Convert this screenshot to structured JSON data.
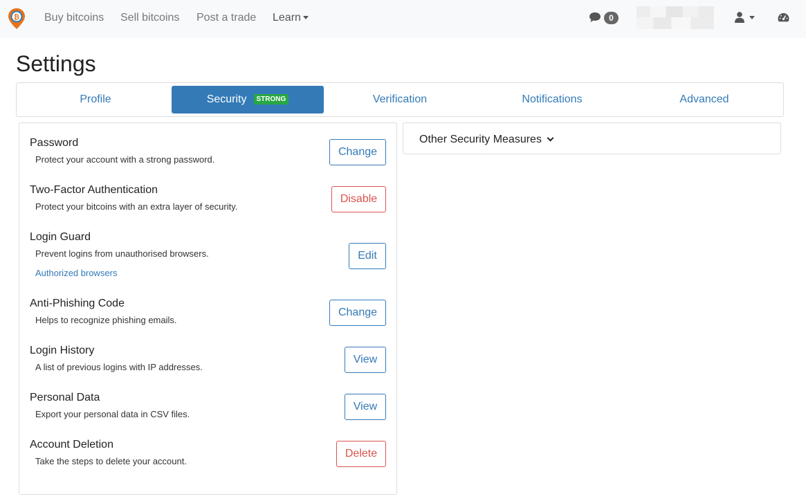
{
  "navbar": {
    "links": {
      "buy": "Buy bitcoins",
      "sell": "Sell bitcoins",
      "post": "Post a trade",
      "learn": "Learn"
    },
    "messages_count": "0"
  },
  "page": {
    "title": "Settings"
  },
  "tabs": {
    "profile": "Profile",
    "security": "Security",
    "security_badge": "STRONG",
    "verification": "Verification",
    "notifications": "Notifications",
    "advanced": "Advanced"
  },
  "security": {
    "password": {
      "title": "Password",
      "desc": "Protect your account with a strong password.",
      "button": "Change"
    },
    "two_factor": {
      "title": "Two-Factor Authentication",
      "desc": "Protect your bitcoins with an extra layer of security.",
      "button": "Disable"
    },
    "login_guard": {
      "title": "Login Guard",
      "desc": "Prevent logins from unauthorised browsers.",
      "link": "Authorized browsers",
      "button": "Edit"
    },
    "anti_phishing": {
      "title": "Anti-Phishing Code",
      "desc": "Helps to recognize phishing emails.",
      "button": "Change"
    },
    "login_history": {
      "title": "Login History",
      "desc": "A list of previous logins with IP addresses.",
      "button": "View"
    },
    "personal_data": {
      "title": "Personal Data",
      "desc": "Export your personal data in CSV files.",
      "button": "View"
    },
    "account_deletion": {
      "title": "Account Deletion",
      "desc": "Take the steps to delete your account.",
      "button": "Delete"
    }
  },
  "other_measures": {
    "label": "Other Security Measures"
  },
  "colors": {
    "primary": "#337ab7",
    "danger": "#d9534f",
    "success": "#28a745",
    "navbar_bg": "#f8f9fa"
  }
}
